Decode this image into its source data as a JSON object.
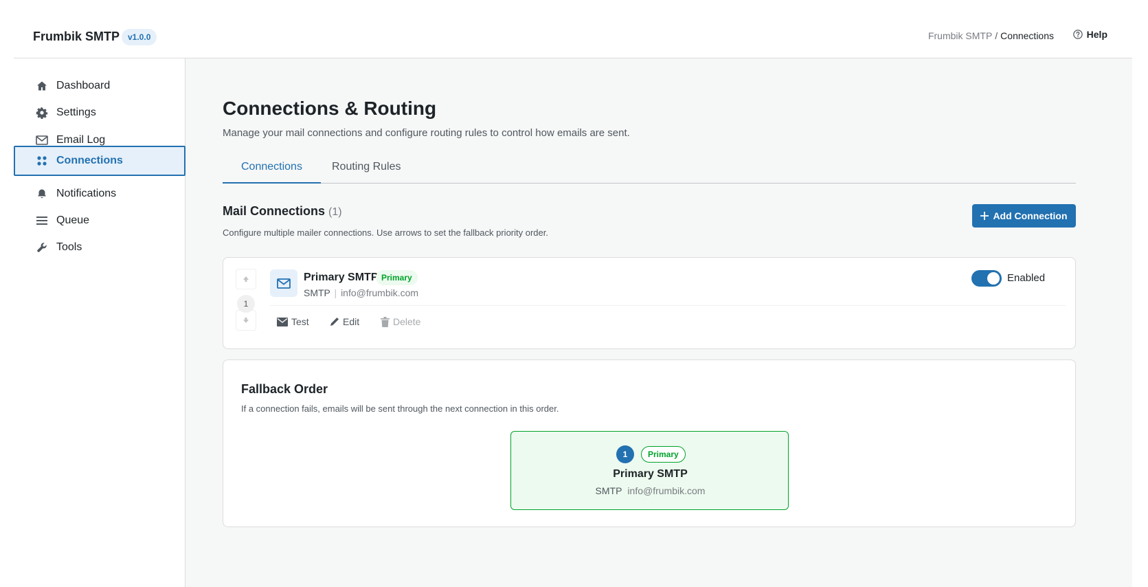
{
  "header": {
    "brand": "Frumbik SMTP",
    "version": "v1.0.0",
    "breadcrumb_root": "Frumbik SMTP",
    "breadcrumb_sep": "/",
    "breadcrumb_current": "Connections",
    "help": "Help"
  },
  "sidebar": {
    "items": [
      {
        "label": "Dashboard",
        "icon": "home-icon"
      },
      {
        "label": "Settings",
        "icon": "gear-icon"
      },
      {
        "label": "Email Log",
        "icon": "envelope-icon"
      },
      {
        "label": "Connections",
        "icon": "grid-dots-icon",
        "active": true
      },
      {
        "label": "Notifications",
        "icon": "bell-icon"
      },
      {
        "label": "Queue",
        "icon": "list-icon"
      },
      {
        "label": "Tools",
        "icon": "wrench-icon"
      }
    ]
  },
  "main": {
    "title": "Connections & Routing",
    "subtitle": "Manage your mail connections and configure routing rules to control how emails are sent.",
    "tabs": [
      {
        "label": "Connections",
        "active": true
      },
      {
        "label": "Routing Rules",
        "active": false
      }
    ],
    "section": {
      "title": "Mail Connections",
      "count": "(1)",
      "description": "Configure multiple mailer connections. Use arrows to set the fallback priority order.",
      "add_button": "Add Connection"
    },
    "connection": {
      "priority": "1",
      "name": "Primary SMTP",
      "badge": "Primary",
      "type": "SMTP",
      "separator": "|",
      "email": "info@frumbik.com",
      "enabled": true,
      "toggle_label": "Enabled",
      "actions": {
        "test": "Test",
        "edit": "Edit",
        "delete": "Delete"
      }
    },
    "fallback": {
      "title": "Fallback Order",
      "description": "If a connection fails, emails will be sent through the next connection in this order.",
      "items": [
        {
          "number": "1",
          "badge": "Primary",
          "name": "Primary SMTP",
          "type": "SMTP",
          "email": "info@frumbik.com"
        }
      ]
    }
  },
  "colors": {
    "accent": "#2271b1",
    "success": "#00a32a",
    "success_bg": "#edfaef"
  }
}
